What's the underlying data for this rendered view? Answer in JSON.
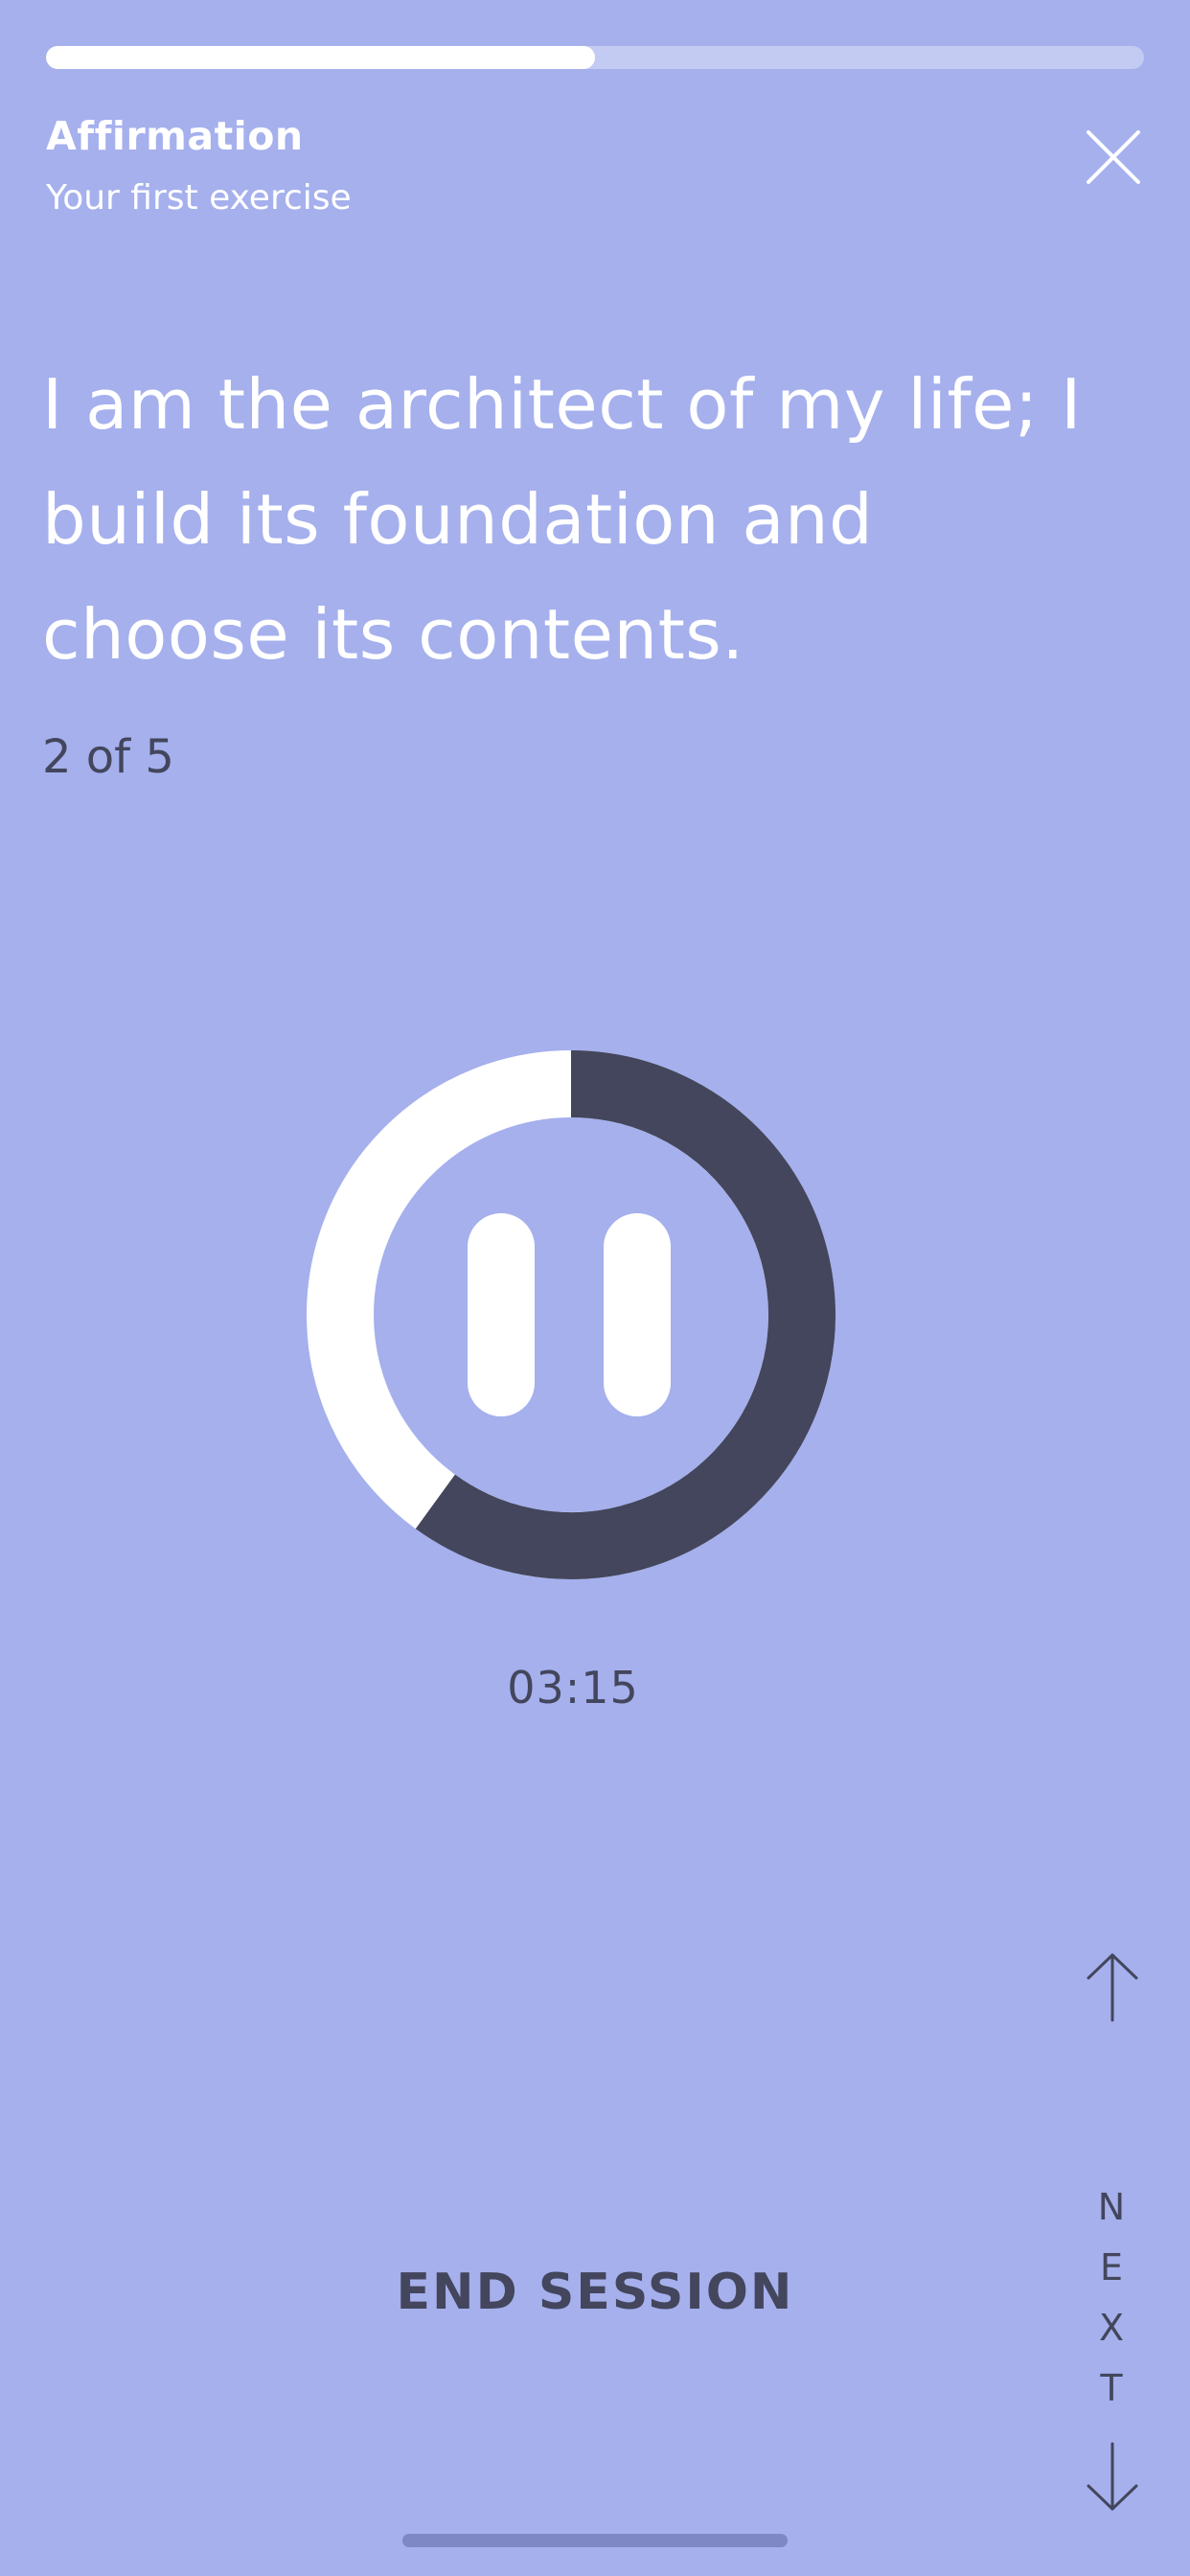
{
  "colors": {
    "background": "#a5b0ed",
    "text_dark": "#43465c",
    "ring_remaining": "#ffffff",
    "ring_elapsed": "#43465c"
  },
  "progress": {
    "fraction": 0.5
  },
  "header": {
    "title": "Affirmation",
    "subtitle": "Your first exercise",
    "close_icon": "close-icon"
  },
  "affirmation": {
    "text": "I am the architect of my life; I build its foundation and choose its contents.",
    "counter": "2 of 5"
  },
  "timer": {
    "elapsed_fraction": 0.6,
    "time_text": "03:15",
    "control_icon": "pause-icon"
  },
  "navigation": {
    "up_icon": "arrow-up-icon",
    "next_letters": [
      "N",
      "E",
      "X",
      "T"
    ],
    "down_icon": "arrow-down-icon"
  },
  "footer": {
    "end_session_label": "END SESSION"
  }
}
